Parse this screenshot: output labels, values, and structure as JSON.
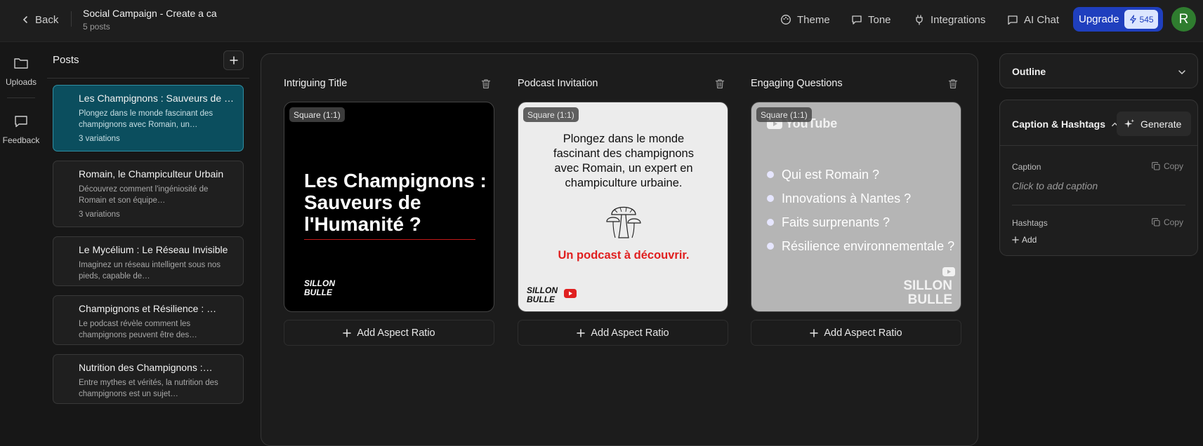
{
  "header": {
    "back_label": "Back",
    "project_title": "Social Campaign - Create a ca",
    "post_count": "5 posts",
    "nav": [
      {
        "label": "Theme",
        "icon": "palette-icon"
      },
      {
        "label": "Tone",
        "icon": "message-square-icon"
      },
      {
        "label": "Integrations",
        "icon": "plug-icon"
      },
      {
        "label": "AI Chat",
        "icon": "chat-icon"
      }
    ],
    "upgrade_label": "Upgrade",
    "credits": "545",
    "avatar_initial": "R"
  },
  "rail": {
    "uploads_label": "Uploads",
    "feedback_label": "Feedback"
  },
  "posts": {
    "heading": "Posts",
    "items": [
      {
        "title": "Les Champignons : Sauveurs de l'Humanité ?",
        "description": "Plongez dans le monde fascinant des champignons avec Romain, un…",
        "variations": "3 variations",
        "active": true
      },
      {
        "title": "Romain, le Champiculteur Urbain",
        "description": "Découvrez comment l'ingéniosité de Romain et son équipe…",
        "variations": "3 variations",
        "active": false
      },
      {
        "title": "Le Mycélium : Le Réseau Invisible",
        "description": "Imaginez un réseau intelligent sous nos pieds, capable de…",
        "variations": "",
        "active": false
      },
      {
        "title": "Champignons et Résilience : …",
        "description": "Le podcast révèle comment les champignons peuvent être des…",
        "variations": "",
        "active": false
      },
      {
        "title": "Nutrition des Champignons :…",
        "description": "Entre mythes et vérités, la nutrition des champignons est un sujet…",
        "variations": "",
        "active": false
      }
    ]
  },
  "columns": [
    {
      "title": "Intriguing Title",
      "badge": "Square (1:1)",
      "add_label": "Add Aspect Ratio",
      "image": {
        "headline": [
          "Les Champignons :",
          "Sauveurs de",
          "l'Humanité ?"
        ],
        "logo": [
          "SILLON",
          "BULLE"
        ]
      }
    },
    {
      "title": "Podcast Invitation",
      "badge": "Square (1:1)",
      "add_label": "Add Aspect Ratio",
      "image": {
        "body": [
          "Plongez dans le monde",
          "fascinant des champignons",
          "avec Romain, un expert en",
          "champiculture urbaine."
        ],
        "cta": "Un podcast à découvrir.",
        "logo": [
          "SILLON",
          "BULLE"
        ]
      }
    },
    {
      "title": "Engaging Questions",
      "badge": "Square (1:1)",
      "add_label": "Add Aspect Ratio",
      "image": {
        "brand": "YouTube",
        "questions": [
          "Qui est Romain ?",
          "Innovations à Nantes ?",
          "Faits surprenants ?",
          "Résilience environnementale ?"
        ],
        "logo": [
          "SILLON",
          "BULLE"
        ]
      }
    }
  ],
  "right_panel": {
    "outline_label": "Outline",
    "caption_section_label": "Caption & Hashtags",
    "generate_label": "Generate",
    "caption_label": "Caption",
    "copy_label": "Copy",
    "caption_placeholder": "Click to add caption",
    "hashtags_label": "Hashtags",
    "add_label": "Add"
  },
  "colors": {
    "accent_active": "#0b4e5e",
    "upgrade_blue": "#1f3fbe",
    "cta_red": "#e02020",
    "avatar_green": "#2f7d2f"
  }
}
